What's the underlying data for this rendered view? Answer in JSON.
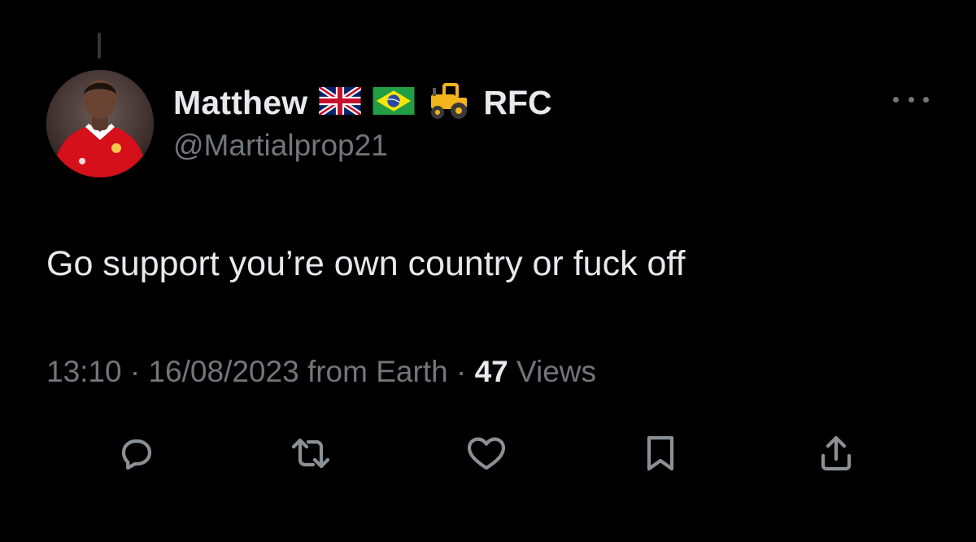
{
  "tweet": {
    "author": {
      "display_name": "Matthew",
      "flags": [
        "uk-flag-icon",
        "brazil-flag-icon",
        "tractor-icon"
      ],
      "suffix": "RFC",
      "handle": "@Martialprop21"
    },
    "text": "Go support you’re own country or fuck off",
    "meta": {
      "time": "13:10",
      "separator": "·",
      "date": "16/08/2023",
      "source": "from Earth",
      "views_count": "47",
      "views_label": "Views"
    },
    "actions": [
      {
        "name": "reply-icon"
      },
      {
        "name": "retweet-icon"
      },
      {
        "name": "like-icon"
      },
      {
        "name": "bookmark-icon"
      },
      {
        "name": "share-icon"
      }
    ]
  },
  "colors": {
    "background": "#000000",
    "primary_text": "#e7e9ea",
    "secondary_text": "#71767b",
    "jersey_red": "#d5101a"
  }
}
